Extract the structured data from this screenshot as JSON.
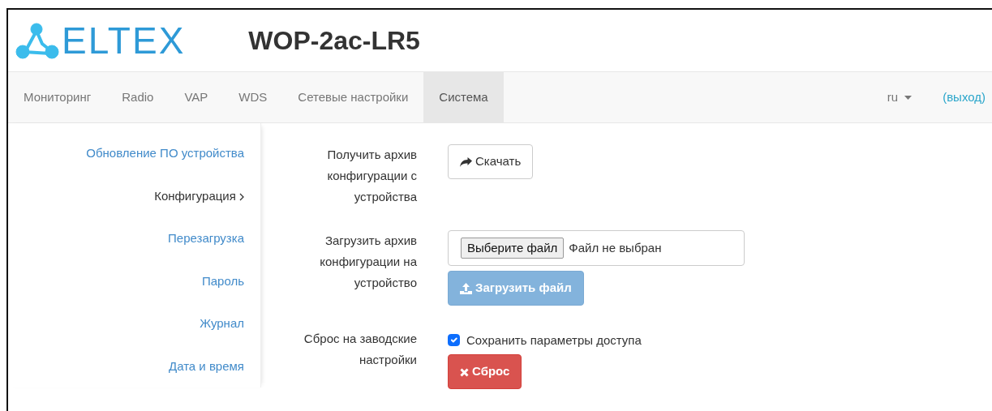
{
  "header": {
    "logo_text": "ELTEX",
    "title": "WOP-2ac-LR5"
  },
  "nav": {
    "items": [
      {
        "label": "Мониторинг",
        "selected": false
      },
      {
        "label": "Radio",
        "selected": false
      },
      {
        "label": "VAP",
        "selected": false
      },
      {
        "label": "WDS",
        "selected": false
      },
      {
        "label": "Сетевые настройки",
        "selected": false
      },
      {
        "label": "Система",
        "selected": true
      }
    ],
    "language": "ru",
    "logout": "(выход)"
  },
  "sidebar": {
    "items": [
      {
        "label": "Обновление ПО устройства",
        "selected": false
      },
      {
        "label": "Конфигурация",
        "selected": true
      },
      {
        "label": "Перезагрузка",
        "selected": false
      },
      {
        "label": "Пароль",
        "selected": false
      },
      {
        "label": "Журнал",
        "selected": false
      },
      {
        "label": "Дата и время",
        "selected": false
      }
    ]
  },
  "form": {
    "rows": [
      {
        "label": "Получить архив конфигурации с устройства",
        "controls": [
          {
            "kind": "download",
            "label": "Скачать"
          }
        ]
      },
      {
        "label": "Загрузить архив конфигурации на устройство",
        "controls": [
          {
            "kind": "file",
            "button": "Выберите файл",
            "value": "Файл не выбран"
          },
          {
            "kind": "upload",
            "label": "Загрузить файл",
            "disabled": true
          }
        ]
      },
      {
        "label": "Сброс на заводские настройки",
        "controls": [
          {
            "kind": "checkbox",
            "label": "Сохранить параметры доступа",
            "checked": true
          },
          {
            "kind": "reset",
            "label": "Сброс"
          }
        ]
      }
    ]
  }
}
